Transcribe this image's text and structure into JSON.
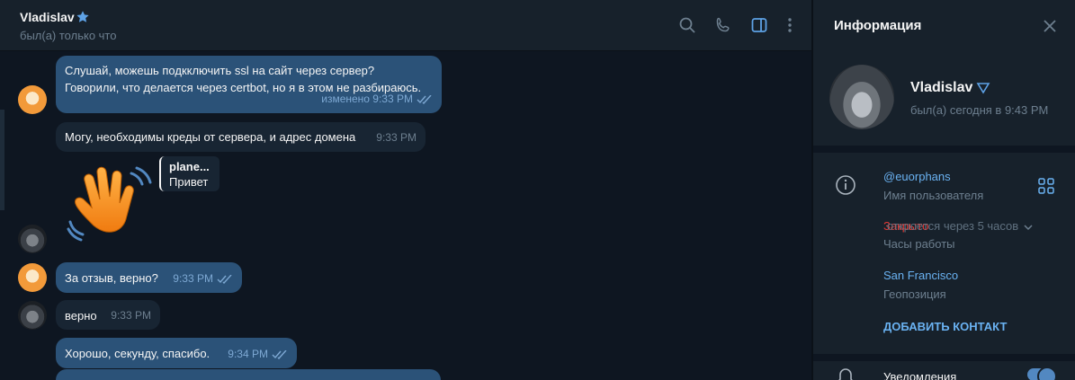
{
  "header": {
    "name": "Vladislav",
    "status": "был(а) только что",
    "icons": [
      "search-icon",
      "phone-icon",
      "sidebar-icon",
      "more-icon"
    ]
  },
  "messages": [
    {
      "from": "me",
      "lines": [
        "Слушай, можешь подкключить ssl на сайт через сервер?",
        "Говорили, что делается через certbot, но я в этом не разбираюсь."
      ],
      "time": "изменено 9:33 PM",
      "read": true
    },
    {
      "from": "me",
      "text": "Могу, необходимы креды от сервера, и адрес домена",
      "time": "9:33 PM"
    },
    {
      "from": "them",
      "type": "sticker",
      "sticker": "waving-hand-icon",
      "reply_name": "plane...",
      "reply_text": "Привет"
    },
    {
      "from": "me",
      "text": "За отзыв, верно?",
      "time": "9:33 PM",
      "read": true
    },
    {
      "from": "them",
      "text": "верно",
      "time": "9:33 PM"
    },
    {
      "from": "me",
      "text": "Хорошо, секунду, спасибо.",
      "time": "9:34 PM",
      "read": true
    }
  ],
  "info": {
    "title": "Информация",
    "name": "Vladislav",
    "seen": "был(а) сегодня в 9:43 PM",
    "username": "@euorphans",
    "username_label": "Имя пользователя",
    "hours_closed": "Закрыто",
    "hours_opens": "откроется через 5 часов",
    "hours_label": "Часы работы",
    "location": "San Francisco",
    "location_label": "Геопозиция",
    "add_contact": "ДОБАВИТЬ КОНТАКТ",
    "notifications": "Уведомления",
    "notifications_on": true
  },
  "colors": {
    "accent": "#5288c1",
    "link": "#6ab2f2",
    "outgoing_bubble": "#2b5278",
    "incoming_bubble": "#182533",
    "closed": "#e53935"
  }
}
